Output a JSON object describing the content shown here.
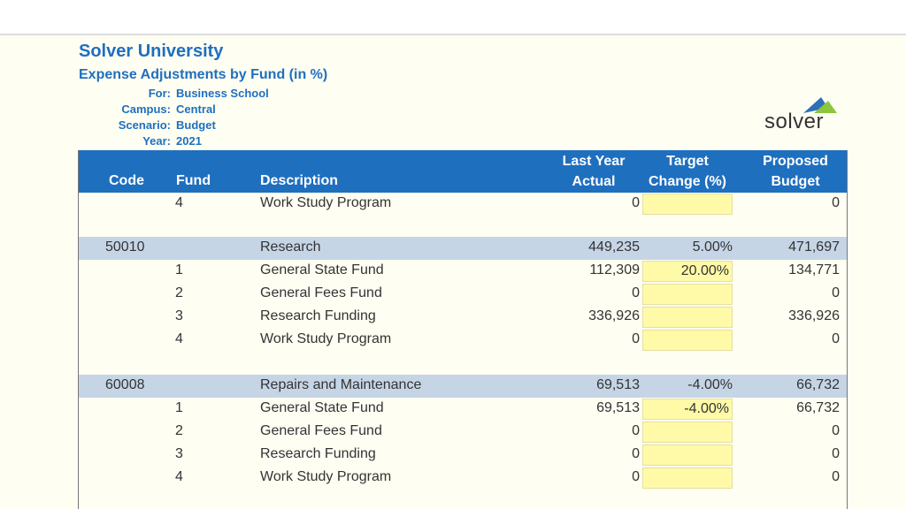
{
  "header": {
    "org": "Solver University",
    "report": "Expense Adjustments by Fund (in %)",
    "labels": [
      "For:",
      "Campus:",
      "Scenario:",
      "Year:"
    ],
    "values": [
      "Business School",
      "Central",
      "Budget",
      "2021"
    ]
  },
  "logo": {
    "text": "solver"
  },
  "columns": {
    "code": "Code",
    "fund": "Fund",
    "desc": "Description",
    "last_year_1": "Last Year",
    "last_year_2": "Actual",
    "target_1": "Target",
    "target_2": "Change (%)",
    "proposed_1": "Proposed",
    "proposed_2": "Budget"
  },
  "rows": [
    {
      "type": "detail",
      "code": "",
      "fund": "4",
      "desc": "Work Study Program",
      "ly": "0",
      "tc": "",
      "pb": "0"
    },
    {
      "type": "group",
      "code": "50010",
      "fund": "",
      "desc": "Research",
      "ly": "449,235",
      "tc": "5.00%",
      "pb": "471,697"
    },
    {
      "type": "detail",
      "code": "",
      "fund": "1",
      "desc": "General State Fund",
      "ly": "112,309",
      "tc": "20.00%",
      "pb": "134,771"
    },
    {
      "type": "detail",
      "code": "",
      "fund": "2",
      "desc": "General Fees Fund",
      "ly": "0",
      "tc": "",
      "pb": "0"
    },
    {
      "type": "detail",
      "code": "",
      "fund": "3",
      "desc": "Research Funding",
      "ly": "336,926",
      "tc": "",
      "pb": "336,926"
    },
    {
      "type": "detail",
      "code": "",
      "fund": "4",
      "desc": "Work Study Program",
      "ly": "0",
      "tc": "",
      "pb": "0"
    },
    {
      "type": "group",
      "code": "60008",
      "fund": "",
      "desc": "Repairs and Maintenance",
      "ly": "69,513",
      "tc": "-4.00%",
      "pb": "66,732"
    },
    {
      "type": "detail",
      "code": "",
      "fund": "1",
      "desc": "General State Fund",
      "ly": "69,513",
      "tc": "-4.00%",
      "pb": "66,732"
    },
    {
      "type": "detail",
      "code": "",
      "fund": "2",
      "desc": "General Fees Fund",
      "ly": "0",
      "tc": "",
      "pb": "0"
    },
    {
      "type": "detail",
      "code": "",
      "fund": "3",
      "desc": "Research Funding",
      "ly": "0",
      "tc": "",
      "pb": "0"
    },
    {
      "type": "detail",
      "code": "",
      "fund": "4",
      "desc": "Work Study Program",
      "ly": "0",
      "tc": "",
      "pb": "0"
    }
  ],
  "colors": {
    "accent": "#1f6fbf",
    "group_row": "#c5d5e6",
    "input_cell": "#fffaa8"
  }
}
